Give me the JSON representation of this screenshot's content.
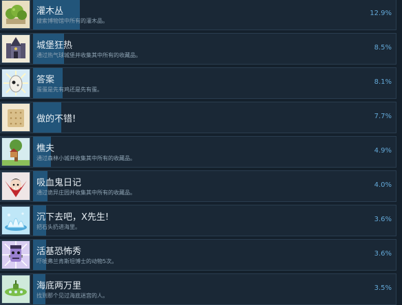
{
  "achievements": [
    {
      "title": "灌木丛",
      "desc": "搜索博物馆中所有的灌木品。",
      "pct": "12.9%",
      "value": 12.9,
      "icon": "green-shrub-icon",
      "color": "#7fb23a"
    },
    {
      "title": "城堡狂热",
      "desc": "通过热气球城堡并收集其中所有的收藏品。",
      "pct": "8.5%",
      "value": 8.5,
      "icon": "castle-icon",
      "color": "#6e6a8a"
    },
    {
      "title": "答案",
      "desc": "蛋蛋是先有鸡还是先有蛋。",
      "pct": "8.1%",
      "value": 8.1,
      "icon": "egg-icon",
      "color": "#e8e3d5"
    },
    {
      "title": "做的不错!",
      "desc": "",
      "pct": "7.7%",
      "value": 7.7,
      "icon": "cracker-icon",
      "color": "#d9bf8a"
    },
    {
      "title": "樵夫",
      "desc": "通过森林小城并收集其中所有的收藏品。",
      "pct": "4.9%",
      "value": 4.9,
      "icon": "tree-house-icon",
      "color": "#5d9a3b"
    },
    {
      "title": "吸血鬼日记",
      "desc": "通过诡异庄园并收集其中所有的收藏品。",
      "pct": "4.0%",
      "value": 4.0,
      "icon": "vampire-icon",
      "color": "#c1272d"
    },
    {
      "title": "沉下去吧，X先生!",
      "desc": "把石头扔进海里。",
      "pct": "3.6%",
      "value": 3.6,
      "icon": "splash-icon",
      "color": "#8fd3f0"
    },
    {
      "title": "活基恐怖秀",
      "desc": "吓唬弗兰肯斯坦博士的动物5次。",
      "pct": "3.6%",
      "value": 3.6,
      "icon": "monster-icon",
      "color": "#9a80d0"
    },
    {
      "title": "海底两万里",
      "desc": "找到那个见过海底迷宫的人。",
      "pct": "3.5%",
      "value": 3.5,
      "icon": "submarine-icon",
      "color": "#7bbf4a"
    }
  ]
}
